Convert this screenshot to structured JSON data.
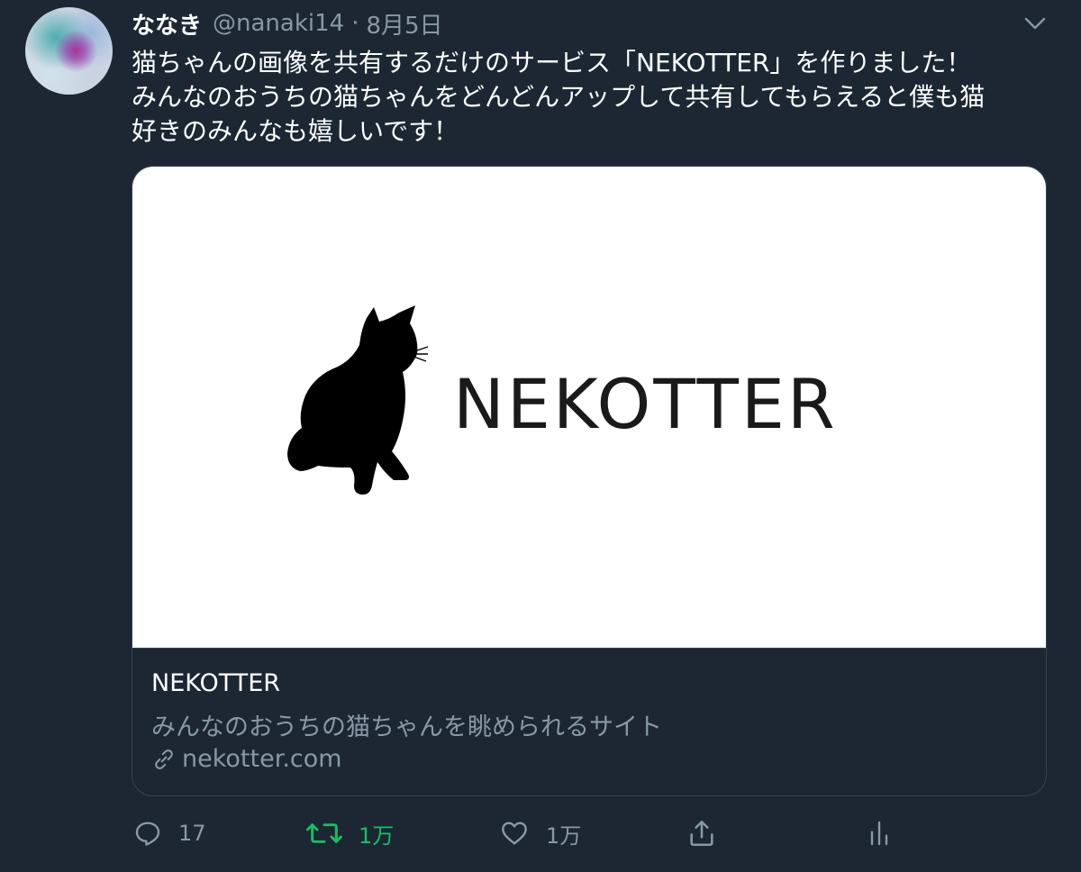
{
  "tweet": {
    "display_name": "ななき",
    "handle": "@nanaki14",
    "separator": "·",
    "date": "8月5日",
    "text": "猫ちゃんの画像を共有するだけのサービス「NEKOTTER」を作りました！\nみんなのおうちの猫ちゃんをどんどんアップして共有してもらえると僕も猫\n好きのみんなも嬉しいです！"
  },
  "card": {
    "logo_text": "NEKOTTER",
    "title": "NEKOTTER",
    "description": "みんなのおうちの猫ちゃんを眺められるサイト",
    "link": "nekotter.com"
  },
  "actions": {
    "reply_count": "17",
    "retweet_count": "1万",
    "like_count": "1万"
  },
  "icons": {
    "more": "chevron-down-icon",
    "reply": "reply-icon",
    "retweet": "retweet-icon",
    "like": "heart-icon",
    "share": "share-icon",
    "analytics": "analytics-icon",
    "link": "link-icon"
  },
  "colors": {
    "background": "#1c2733",
    "text_primary": "#ffffff",
    "text_secondary": "#8899a6",
    "border": "#38444d",
    "retweet_active": "#17bf63"
  }
}
